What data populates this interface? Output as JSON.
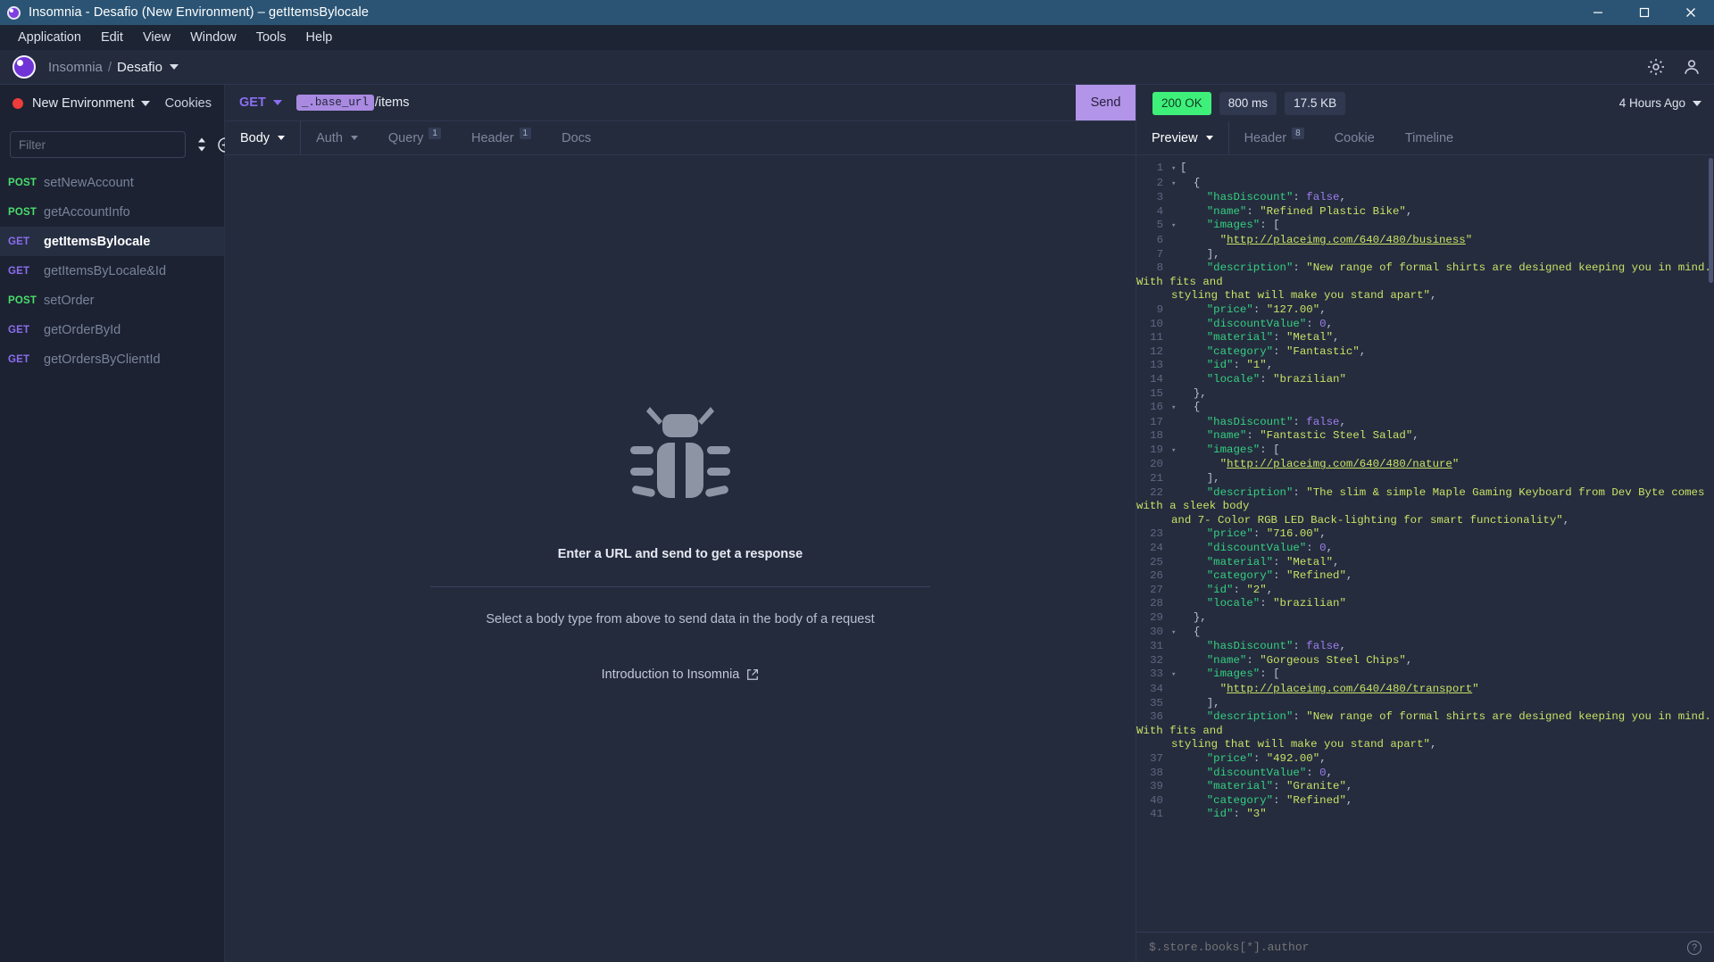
{
  "titlebar": {
    "title": "Insomnia - Desafio (New Environment) – getItemsBylocale",
    "minimize": "minimize-icon",
    "maximize": "maximize-icon",
    "close": "close-icon"
  },
  "menubar": {
    "items": [
      "Application",
      "Edit",
      "View",
      "Window",
      "Tools",
      "Help"
    ]
  },
  "workspace": {
    "app_name": "Insomnia",
    "separator": "/",
    "project": "Desafio",
    "settings_icon": "gear-icon",
    "account_icon": "user-icon"
  },
  "sidebar": {
    "environment": "New Environment",
    "environment_color": "#ee3b3b",
    "cookies": "Cookies",
    "filter_placeholder": "Filter",
    "sort_icon": "sort-icon",
    "add_icon": "plus-icon",
    "requests": [
      {
        "method": "POST",
        "name": "setNewAccount",
        "active": false
      },
      {
        "method": "POST",
        "name": "getAccountInfo",
        "active": false
      },
      {
        "method": "GET",
        "name": "getItemsBylocale",
        "active": true
      },
      {
        "method": "GET",
        "name": "getItemsByLocale&Id",
        "active": false
      },
      {
        "method": "POST",
        "name": "setOrder",
        "active": false
      },
      {
        "method": "GET",
        "name": "getOrderById",
        "active": false
      },
      {
        "method": "GET",
        "name": "getOrdersByClientId",
        "active": false
      }
    ]
  },
  "request": {
    "method": "GET",
    "url_variable": "_.base_url",
    "url_path": "/items",
    "send_label": "Send",
    "tabs": [
      {
        "label": "Body",
        "badge": "",
        "active": true,
        "caret": true
      },
      {
        "label": "Auth",
        "badge": "",
        "active": false,
        "caret": true
      },
      {
        "label": "Query",
        "badge": "1",
        "active": false,
        "caret": false
      },
      {
        "label": "Header",
        "badge": "1",
        "active": false,
        "caret": false
      },
      {
        "label": "Docs",
        "badge": "",
        "active": false,
        "caret": false
      }
    ],
    "empty_title": "Enter a URL and send to get a response",
    "empty_subtitle": "Select a body type from above to send data in the body of a request",
    "intro_link": "Introduction to Insomnia",
    "bug_icon": "bug-icon",
    "external-link-icon": "external-link-icon"
  },
  "response": {
    "status": "200 OK",
    "status_color": "#3ef07a",
    "time": "800 ms",
    "size": "17.5 KB",
    "history": "4 Hours Ago",
    "tabs": [
      {
        "label": "Preview",
        "badge": "",
        "active": true,
        "caret": true
      },
      {
        "label": "Header",
        "badge": "8",
        "active": false,
        "caret": false
      },
      {
        "label": "Cookie",
        "badge": "",
        "active": false,
        "caret": false
      },
      {
        "label": "Timeline",
        "badge": "",
        "active": false,
        "caret": false
      }
    ],
    "jsonpath_placeholder": "$.store.books[*].author",
    "help_icon": "help-icon",
    "body_lines": [
      {
        "n": "1",
        "fold": true,
        "html": "<span class=\"p\">[</span>"
      },
      {
        "n": "2",
        "fold": true,
        "html": "  <span class=\"p\">{</span>"
      },
      {
        "n": "3",
        "fold": false,
        "html": "    <span class=\"k\">\"hasDiscount\"</span><span class=\"p\">: </span><span class=\"n\">false</span><span class=\"p\">,</span>"
      },
      {
        "n": "4",
        "fold": false,
        "html": "    <span class=\"k\">\"name\"</span><span class=\"p\">: </span><span class=\"s\">\"Refined Plastic Bike\"</span><span class=\"p\">,</span>"
      },
      {
        "n": "5",
        "fold": true,
        "html": "    <span class=\"k\">\"images\"</span><span class=\"p\">: [</span>"
      },
      {
        "n": "6",
        "fold": false,
        "html": "      <span class=\"s\">\"</span><span class=\"u\">http://placeimg.com/640/480/business</span><span class=\"s\">\"</span>"
      },
      {
        "n": "7",
        "fold": false,
        "html": "    <span class=\"p\">],</span>"
      },
      {
        "n": "8",
        "fold": false,
        "html": "    <span class=\"k\">\"description\"</span><span class=\"p\">: </span><span class=\"s\">\"New range of formal shirts are designed keeping you in mind. With fits and</span>\n<span class=\"cont\"><span class=\"s\">styling that will make you stand apart\"</span><span class=\"p\">,</span></span>"
      },
      {
        "n": "9",
        "fold": false,
        "html": "    <span class=\"k\">\"price\"</span><span class=\"p\">: </span><span class=\"s\">\"127.00\"</span><span class=\"p\">,</span>"
      },
      {
        "n": "10",
        "fold": false,
        "html": "    <span class=\"k\">\"discountValue\"</span><span class=\"p\">: </span><span class=\"n\">0</span><span class=\"p\">,</span>"
      },
      {
        "n": "11",
        "fold": false,
        "html": "    <span class=\"k\">\"material\"</span><span class=\"p\">: </span><span class=\"s\">\"Metal\"</span><span class=\"p\">,</span>"
      },
      {
        "n": "12",
        "fold": false,
        "html": "    <span class=\"k\">\"category\"</span><span class=\"p\">: </span><span class=\"s\">\"Fantastic\"</span><span class=\"p\">,</span>"
      },
      {
        "n": "13",
        "fold": false,
        "html": "    <span class=\"k\">\"id\"</span><span class=\"p\">: </span><span class=\"s\">\"1\"</span><span class=\"p\">,</span>"
      },
      {
        "n": "14",
        "fold": false,
        "html": "    <span class=\"k\">\"locale\"</span><span class=\"p\">: </span><span class=\"s\">\"brazilian\"</span>"
      },
      {
        "n": "15",
        "fold": false,
        "html": "  <span class=\"p\">},</span>"
      },
      {
        "n": "16",
        "fold": true,
        "html": "  <span class=\"p\">{</span>"
      },
      {
        "n": "17",
        "fold": false,
        "html": "    <span class=\"k\">\"hasDiscount\"</span><span class=\"p\">: </span><span class=\"n\">false</span><span class=\"p\">,</span>"
      },
      {
        "n": "18",
        "fold": false,
        "html": "    <span class=\"k\">\"name\"</span><span class=\"p\">: </span><span class=\"s\">\"Fantastic Steel Salad\"</span><span class=\"p\">,</span>"
      },
      {
        "n": "19",
        "fold": true,
        "html": "    <span class=\"k\">\"images\"</span><span class=\"p\">: [</span>"
      },
      {
        "n": "20",
        "fold": false,
        "html": "      <span class=\"s\">\"</span><span class=\"u\">http://placeimg.com/640/480/nature</span><span class=\"s\">\"</span>"
      },
      {
        "n": "21",
        "fold": false,
        "html": "    <span class=\"p\">],</span>"
      },
      {
        "n": "22",
        "fold": false,
        "html": "    <span class=\"k\">\"description\"</span><span class=\"p\">: </span><span class=\"s\">\"The slim &amp; simple Maple Gaming Keyboard from Dev Byte comes with a sleek body</span>\n<span class=\"cont\"><span class=\"s\">and 7- Color RGB LED Back-lighting for smart functionality\"</span><span class=\"p\">,</span></span>"
      },
      {
        "n": "23",
        "fold": false,
        "html": "    <span class=\"k\">\"price\"</span><span class=\"p\">: </span><span class=\"s\">\"716.00\"</span><span class=\"p\">,</span>"
      },
      {
        "n": "24",
        "fold": false,
        "html": "    <span class=\"k\">\"discountValue\"</span><span class=\"p\">: </span><span class=\"n\">0</span><span class=\"p\">,</span>"
      },
      {
        "n": "25",
        "fold": false,
        "html": "    <span class=\"k\">\"material\"</span><span class=\"p\">: </span><span class=\"s\">\"Metal\"</span><span class=\"p\">,</span>"
      },
      {
        "n": "26",
        "fold": false,
        "html": "    <span class=\"k\">\"category\"</span><span class=\"p\">: </span><span class=\"s\">\"Refined\"</span><span class=\"p\">,</span>"
      },
      {
        "n": "27",
        "fold": false,
        "html": "    <span class=\"k\">\"id\"</span><span class=\"p\">: </span><span class=\"s\">\"2\"</span><span class=\"p\">,</span>"
      },
      {
        "n": "28",
        "fold": false,
        "html": "    <span class=\"k\">\"locale\"</span><span class=\"p\">: </span><span class=\"s\">\"brazilian\"</span>"
      },
      {
        "n": "29",
        "fold": false,
        "html": "  <span class=\"p\">},</span>"
      },
      {
        "n": "30",
        "fold": true,
        "html": "  <span class=\"p\">{</span>"
      },
      {
        "n": "31",
        "fold": false,
        "html": "    <span class=\"k\">\"hasDiscount\"</span><span class=\"p\">: </span><span class=\"n\">false</span><span class=\"p\">,</span>"
      },
      {
        "n": "32",
        "fold": false,
        "html": "    <span class=\"k\">\"name\"</span><span class=\"p\">: </span><span class=\"s\">\"Gorgeous Steel Chips\"</span><span class=\"p\">,</span>"
      },
      {
        "n": "33",
        "fold": true,
        "html": "    <span class=\"k\">\"images\"</span><span class=\"p\">: [</span>"
      },
      {
        "n": "34",
        "fold": false,
        "html": "      <span class=\"s\">\"</span><span class=\"u\">http://placeimg.com/640/480/transport</span><span class=\"s\">\"</span>"
      },
      {
        "n": "35",
        "fold": false,
        "html": "    <span class=\"p\">],</span>"
      },
      {
        "n": "36",
        "fold": false,
        "html": "    <span class=\"k\">\"description\"</span><span class=\"p\">: </span><span class=\"s\">\"New range of formal shirts are designed keeping you in mind. With fits and</span>\n<span class=\"cont\"><span class=\"s\">styling that will make you stand apart\"</span><span class=\"p\">,</span></span>"
      },
      {
        "n": "37",
        "fold": false,
        "html": "    <span class=\"k\">\"price\"</span><span class=\"p\">: </span><span class=\"s\">\"492.00\"</span><span class=\"p\">,</span>"
      },
      {
        "n": "38",
        "fold": false,
        "html": "    <span class=\"k\">\"discountValue\"</span><span class=\"p\">: </span><span class=\"n\">0</span><span class=\"p\">,</span>"
      },
      {
        "n": "39",
        "fold": false,
        "html": "    <span class=\"k\">\"material\"</span><span class=\"p\">: </span><span class=\"s\">\"Granite\"</span><span class=\"p\">,</span>"
      },
      {
        "n": "40",
        "fold": false,
        "html": "    <span class=\"k\">\"category\"</span><span class=\"p\">: </span><span class=\"s\">\"Refined\"</span><span class=\"p\">,</span>"
      },
      {
        "n": "41",
        "fold": false,
        "html": "    <span class=\"k\">\"id\"</span><span class=\"p\">: </span><span class=\"s\">\"3\"</span>"
      }
    ]
  }
}
